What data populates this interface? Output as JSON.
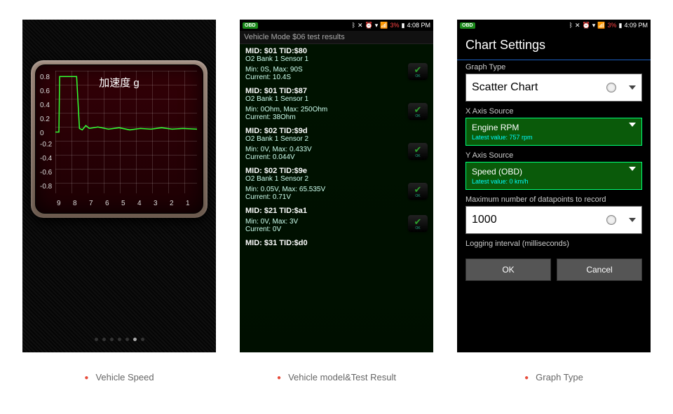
{
  "captions": {
    "p1": "Vehicle Speed",
    "p2": "Vehicle model&Test Result",
    "p3": "Graph Type"
  },
  "chart_data": {
    "type": "line",
    "title": "加速度 g",
    "ylabel": "",
    "xlabel": "",
    "ylim": [
      -0.9,
      0.9
    ],
    "xlim": [
      9,
      1
    ],
    "y_ticks": [
      0.8,
      0.6,
      0.4,
      0.2,
      0,
      -0.2,
      -0.4,
      -0.6,
      -0.8
    ],
    "x_ticks": [
      9,
      8,
      7,
      6,
      5,
      4,
      3,
      2,
      1
    ],
    "x": [
      9.0,
      8.8,
      8.75,
      8.7,
      8.6,
      8.5,
      8.4,
      8.3,
      8.2,
      8.1,
      8.0,
      7.5,
      7.0,
      6.5,
      6.0,
      5.5,
      5.0,
      4.5,
      4.0,
      3.5,
      3.0,
      2.5,
      2.0,
      1.5,
      1.0
    ],
    "y": [
      0.0,
      0.0,
      0.85,
      0.85,
      0.85,
      0.85,
      0.05,
      0.02,
      0.1,
      0.05,
      0.08,
      0.04,
      0.07,
      0.03,
      0.06,
      0.05,
      0.03,
      0.06,
      0.04,
      0.05,
      0.03,
      0.05,
      0.04,
      0.03,
      0.05
    ]
  },
  "status": {
    "time1": "4:08 PM",
    "time2": "4:09 PM",
    "battery": "3%",
    "obd": "OBD"
  },
  "results": {
    "title": "Vehicle Mode $06 test results",
    "items": [
      {
        "midtid": "MID: $01 TID:$80",
        "sensor": "O2 Bank 1 Sensor 1",
        "min": "Min: 0S, Max: 90S",
        "current": "Current: 10.4S"
      },
      {
        "midtid": "MID: $01 TID:$87",
        "sensor": "O2 Bank 1 Sensor 1",
        "min": "Min: 0Ohm, Max: 250Ohm",
        "current": "Current: 38Ohm"
      },
      {
        "midtid": "MID: $02 TID:$9d",
        "sensor": "O2 Bank 1 Sensor 2",
        "min": "Min: 0V, Max: 0.433V",
        "current": "Current: 0.044V"
      },
      {
        "midtid": "MID: $02 TID:$9e",
        "sensor": "O2 Bank 1 Sensor 2",
        "min": "Min: 0.05V, Max: 65.535V",
        "current": "Current: 0.71V"
      },
      {
        "midtid": "MID: $21 TID:$a1",
        "sensor": "",
        "min": "Min: 0V, Max: 3V",
        "current": "Current: 0V"
      },
      {
        "midtid": "MID: $31 TID:$d0",
        "sensor": "",
        "min": "",
        "current": ""
      }
    ]
  },
  "settings": {
    "title": "Chart Settings",
    "graph_type_label": "Graph Type",
    "graph_type_value": "Scatter Chart",
    "x_axis_label": "X Axis Source",
    "x_axis_value": "Engine RPM",
    "x_axis_latest": "Latest value: 757 rpm",
    "y_axis_label": "Y Axis Source",
    "y_axis_value": "Speed (OBD)",
    "y_axis_latest": "Latest value: 0 km/h",
    "max_dp_label": "Maximum number of datapoints to record",
    "max_dp_value": "1000",
    "interval_label": "Logging interval (milliseconds)",
    "ok": "OK",
    "cancel": "Cancel"
  }
}
